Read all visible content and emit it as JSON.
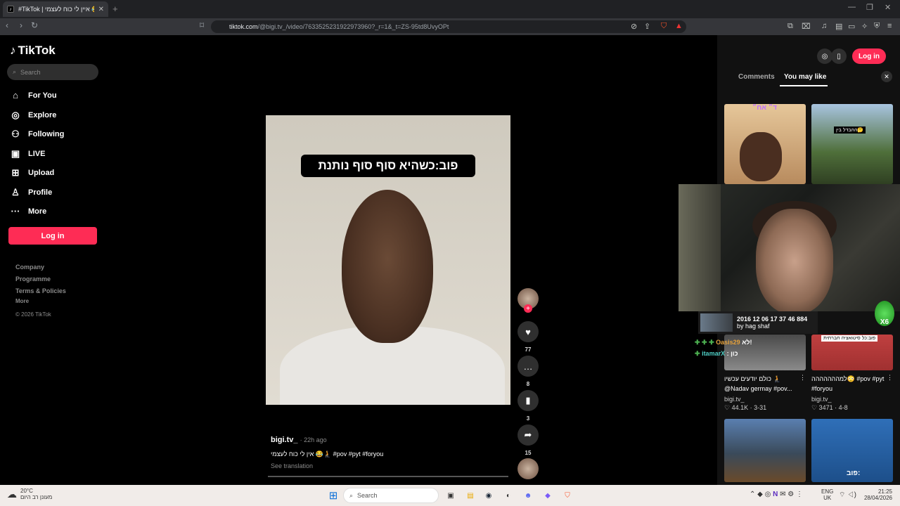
{
  "browser": {
    "tab_title": "#TikTok | איין לי כוח לעצמי 😂🧎",
    "url_host": "tiktok.com",
    "url_path": "/@bigi.tv_/video/7633525231922973960?_r=1&_t=ZS-95td8UvyOPt"
  },
  "tiktok": {
    "logo": "TikTok",
    "search_placeholder": "Search",
    "nav": [
      {
        "label": "For You",
        "icon": "home-icon"
      },
      {
        "label": "Explore",
        "icon": "compass-icon"
      },
      {
        "label": "Following",
        "icon": "person-icon"
      },
      {
        "label": "LIVE",
        "icon": "live-icon"
      },
      {
        "label": "Upload",
        "icon": "plus-square-icon"
      },
      {
        "label": "Profile",
        "icon": "profile-icon"
      },
      {
        "label": "More",
        "icon": "more-icon"
      }
    ],
    "login": "Log in",
    "footer": [
      "Company",
      "Programme",
      "Terms & Policies",
      "More",
      "© 2026 TikTok"
    ]
  },
  "video": {
    "caption_overlay": "פוב:כשהיא סוף סוף נותנת",
    "likes": "77",
    "comments": "8",
    "saves": "3",
    "shares": "15",
    "author": "bigi.tv_",
    "time_ago": "· 22h ago",
    "description": "אין לי כוח לעצמי 😂🧎 #pov #pyt #foryou",
    "see_translation": "See translation"
  },
  "right_panel": {
    "login": "Log in",
    "tab_comments": "Comments",
    "tab_like": "You may like",
    "cards": [
      {
        "overlay": "ד״ אח״",
        "label": "",
        "user": "",
        "likes": "",
        "date": ""
      },
      {
        "overlay": "ההבדל בין🤔",
        "label": "",
        "user": "",
        "likes": "",
        "date": ""
      },
      {
        "overlay": "",
        "label": "כולם יודעים עכשיו 🧎 @Nadav germay #pov...",
        "user": "bigi.tv_",
        "likes": "44.1K",
        "date": "3-31"
      },
      {
        "overlay": "פוב:כל סיטואציה חברתית",
        "label": "למההההההה😳 #pov #pyt #foryou",
        "user": "bigi.tv_",
        "likes": "3471",
        "date": "4-8"
      },
      {
        "overlay": "",
        "label": "",
        "user": "",
        "likes": "",
        "date": ""
      },
      {
        "overlay": "פוב:",
        "label": "",
        "user": "",
        "likes": "",
        "date": ""
      }
    ]
  },
  "stream_overlay": {
    "now_playing_title": "2016 12 06 17 37 46 884",
    "now_playing_by": "by hag shaf",
    "chat": [
      {
        "user": "Oasis29",
        "msg": "לא!",
        "color": "#e6a23c"
      },
      {
        "user": "itamarX",
        "msg": "כון",
        "color": "#4ecdc4"
      }
    ],
    "badge": "X6"
  },
  "taskbar": {
    "temp": "20°C",
    "weather_text": "מעונן רב היום",
    "search": "Search",
    "lang": "ENG",
    "lang2": "UK",
    "time": "21:25",
    "date": "28/04/2026"
  }
}
